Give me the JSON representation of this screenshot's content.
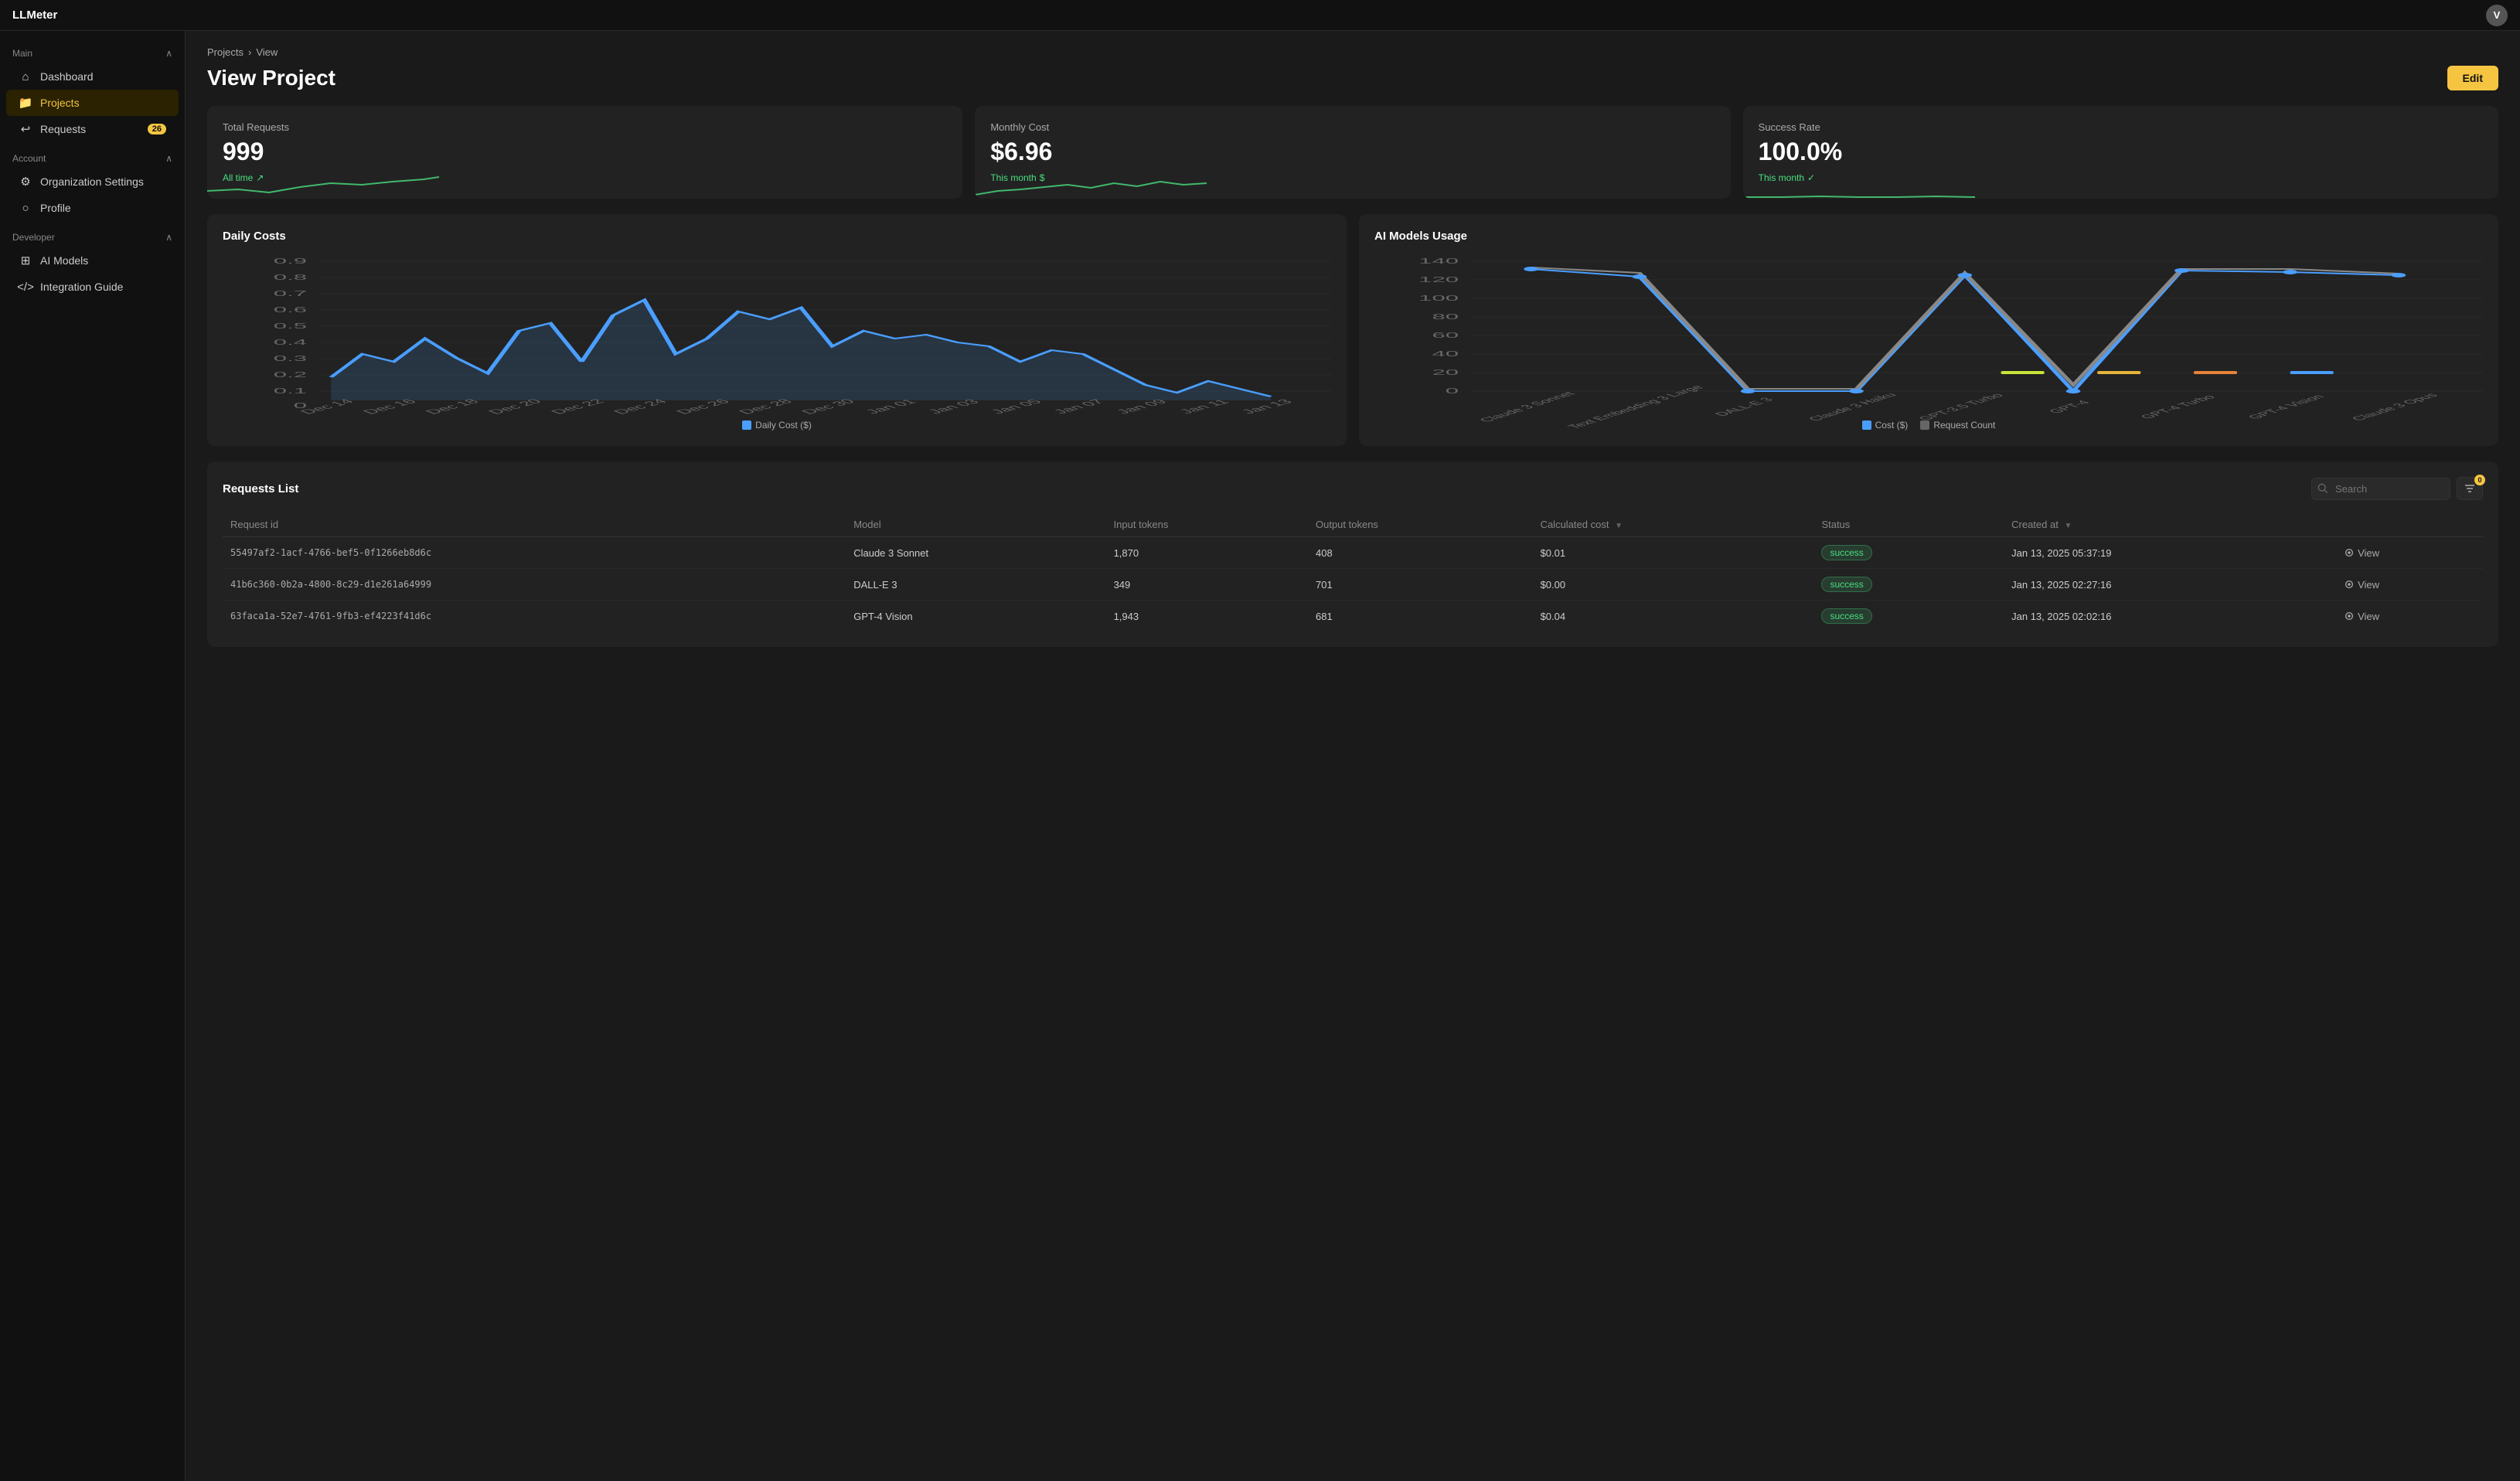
{
  "app": {
    "name": "LLMeter",
    "avatar": "V"
  },
  "sidebar": {
    "main_section": "Main",
    "account_section": "Account",
    "developer_section": "Developer",
    "items": {
      "dashboard": "Dashboard",
      "projects": "Projects",
      "requests": "Requests",
      "requests_badge": "26",
      "organization_settings": "Organization Settings",
      "profile": "Profile",
      "ai_models": "AI Models",
      "integration_guide": "Integration Guide"
    }
  },
  "breadcrumb": {
    "parent": "Projects",
    "separator": "›",
    "current": "View"
  },
  "header": {
    "title": "View Project",
    "edit_button": "Edit"
  },
  "stats": {
    "total_requests": {
      "label": "Total Requests",
      "value": "999",
      "sub": "All time",
      "icon": "↗"
    },
    "monthly_cost": {
      "label": "Monthly Cost",
      "value": "$6.96",
      "sub": "This month",
      "icon": "$"
    },
    "success_rate": {
      "label": "Success Rate",
      "value": "100.0%",
      "sub": "This month",
      "icon": "✓"
    }
  },
  "daily_costs": {
    "title": "Daily Costs",
    "legend_label": "Daily Cost ($)",
    "y_labels": [
      "0",
      "0.1",
      "0.2",
      "0.3",
      "0.4",
      "0.5",
      "0.6",
      "0.7",
      "0.8",
      "0.9"
    ],
    "x_labels": [
      "Dec 14",
      "Dec 16",
      "Dec 18",
      "Dec 20",
      "Dec 22",
      "Dec 24",
      "Dec 26",
      "Dec 28",
      "Dec 30",
      "Jan 01",
      "Jan 03",
      "Jan 05",
      "Jan 07",
      "Jan 09",
      "Jan 11",
      "Jan 13"
    ]
  },
  "ai_models": {
    "title": "AI Models Usage",
    "legend": {
      "cost": "Cost ($)",
      "request_count": "Request Count"
    },
    "x_labels": [
      "Claude 3 Sonnet",
      "Text Embedding 3 Large",
      "DALL-E 3",
      "Claude 3 Haiku",
      "GPT-3.5 Turbo",
      "GPT-4",
      "GPT-4 Turbo",
      "GPT-4 Vision",
      "Claude 3 Opus"
    ],
    "y_labels": [
      "0",
      "20",
      "40",
      "60",
      "80",
      "100",
      "120",
      "140"
    ]
  },
  "requests_list": {
    "title": "Requests List",
    "search_placeholder": "Search",
    "filter_badge": "0",
    "columns": {
      "request_id": "Request id",
      "model": "Model",
      "input_tokens": "Input tokens",
      "output_tokens": "Output tokens",
      "calculated_cost": "Calculated cost",
      "status": "Status",
      "created_at": "Created at"
    },
    "rows": [
      {
        "id": "55497af2-1acf-4766-bef5-0f1266eb8d6c",
        "model": "Claude 3 Sonnet",
        "input_tokens": "1,870",
        "output_tokens": "408",
        "cost": "$0.01",
        "status": "success",
        "created_at": "Jan 13, 2025 05:37:19",
        "view": "View"
      },
      {
        "id": "41b6c360-0b2a-4800-8c29-d1e261a64999",
        "model": "DALL-E 3",
        "input_tokens": "349",
        "output_tokens": "701",
        "cost": "$0.00",
        "status": "success",
        "created_at": "Jan 13, 2025 02:27:16",
        "view": "View"
      },
      {
        "id": "63faca1a-52e7-4761-9fb3-ef4223f41d6c",
        "model": "GPT-4 Vision",
        "input_tokens": "1,943",
        "output_tokens": "681",
        "cost": "$0.04",
        "status": "success",
        "created_at": "Jan 13, 2025 02:02:16",
        "view": "View"
      }
    ]
  },
  "colors": {
    "accent": "#f5c542",
    "green": "#4ade80",
    "blue_chart": "#4a9eff",
    "bg_card": "#222222",
    "bg_dark": "#111111"
  }
}
